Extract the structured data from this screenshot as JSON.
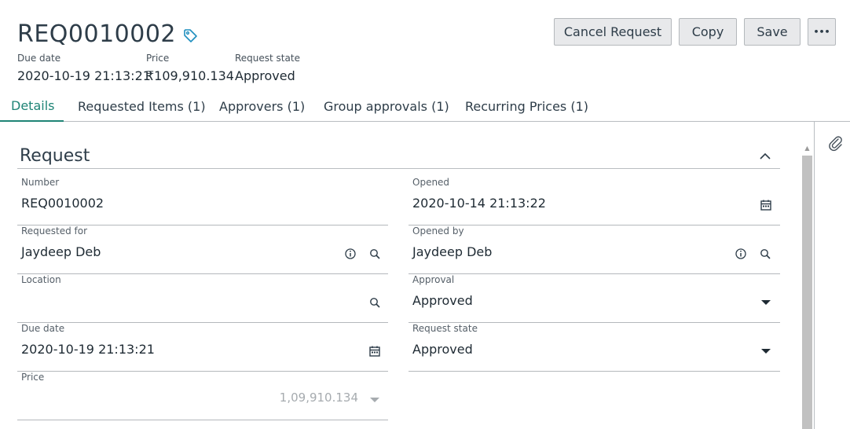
{
  "record": {
    "number": "REQ0010002",
    "header_fields": [
      {
        "label": "Due date",
        "value": "2020-10-19 21:13:21"
      },
      {
        "label": "Price",
        "value": "₹109,910.134"
      },
      {
        "label": "Request state",
        "value": "Approved"
      }
    ]
  },
  "actions": {
    "cancel_request": "Cancel Request",
    "copy": "Copy",
    "save": "Save",
    "more": "•••"
  },
  "tabs": [
    {
      "label": "Details",
      "active": true
    },
    {
      "label": "Requested Items (1)"
    },
    {
      "label": "Approvers (1)"
    },
    {
      "label": "Group approvals (1)"
    },
    {
      "label": "Recurring Prices (1)"
    }
  ],
  "section": {
    "title": "Request"
  },
  "form": {
    "number": {
      "label": "Number",
      "value": "REQ0010002"
    },
    "opened": {
      "label": "Opened",
      "value": "2020-10-14 21:13:22"
    },
    "requested_for": {
      "label": "Requested for",
      "value": "Jaydeep Deb"
    },
    "opened_by": {
      "label": "Opened by",
      "value": "Jaydeep Deb"
    },
    "location": {
      "label": "Location",
      "value": ""
    },
    "approval": {
      "label": "Approval",
      "value": "Approved"
    },
    "due_date": {
      "label": "Due date",
      "value": "2020-10-19 21:13:21"
    },
    "request_state": {
      "label": "Request state",
      "value": "Approved"
    },
    "price": {
      "label": "Price",
      "value": "1,09,910.134"
    }
  },
  "colors": {
    "accent": "#1f8476",
    "text": "#2e3d49",
    "button_bg": "#e8e9eb",
    "border": "#b4b8bc"
  },
  "icons": [
    "tag-icon",
    "paperclip-icon",
    "chevron-up-icon",
    "info-icon",
    "search-icon",
    "calendar-icon",
    "caret-down-icon"
  ]
}
